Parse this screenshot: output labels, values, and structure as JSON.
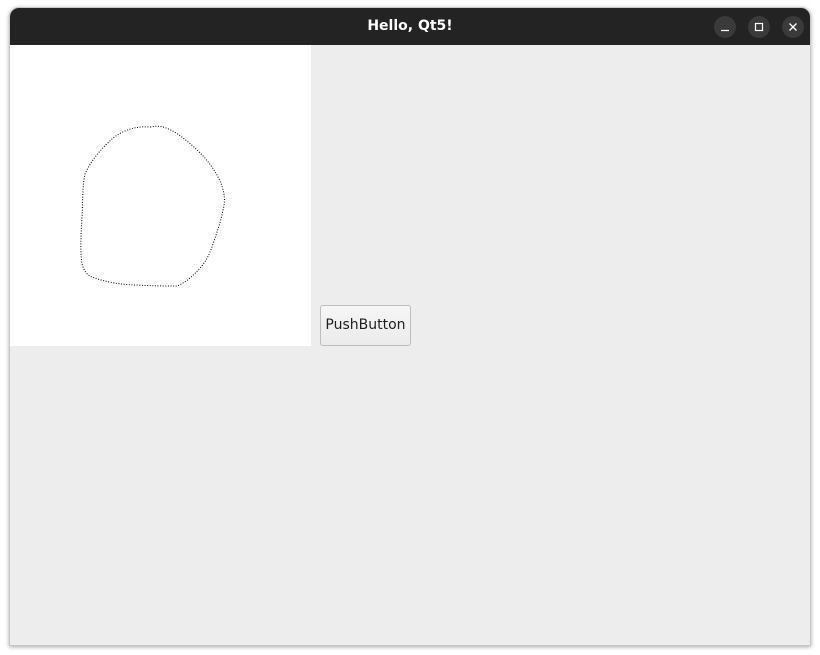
{
  "window": {
    "title": "Hello, Qt5!"
  },
  "titlebar_buttons": [
    {
      "name": "minimize",
      "icon": "minimize-icon"
    },
    {
      "name": "maximize",
      "icon": "maximize-icon"
    },
    {
      "name": "close",
      "icon": "close-icon"
    }
  ],
  "content": {
    "push_button_label": "PushButton"
  },
  "colors": {
    "titlebar_bg": "#232323",
    "title_text": "#ffffff",
    "window_bg": "#ededed",
    "canvas_bg": "#ffffff",
    "stroke": "#000000"
  }
}
